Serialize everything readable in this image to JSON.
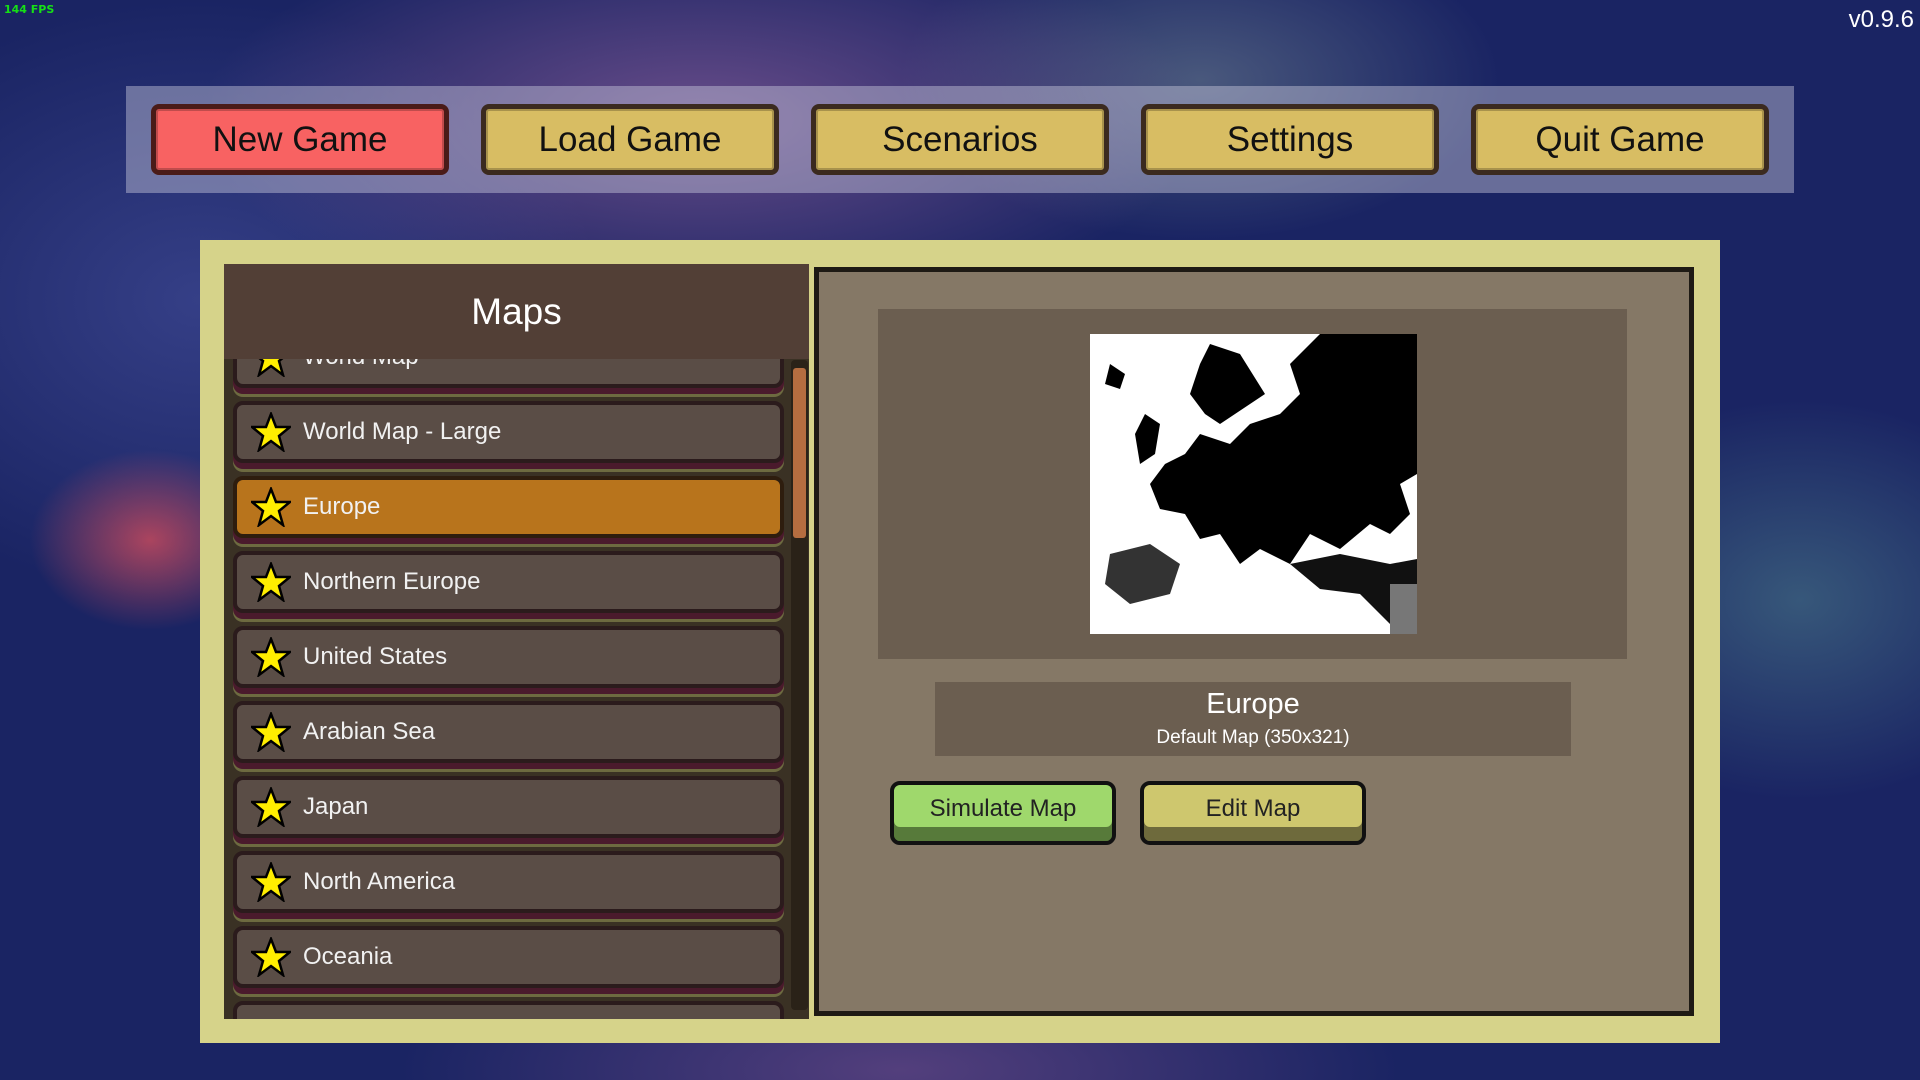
{
  "fps": "144 FPS",
  "version": "v0.9.6",
  "menu": [
    {
      "label": "New Game",
      "active": true
    },
    {
      "label": "Load Game"
    },
    {
      "label": "Scenarios"
    },
    {
      "label": "Settings"
    },
    {
      "label": "Quit Game"
    }
  ],
  "maps": {
    "title": "Maps",
    "items": [
      "World Map",
      "World Map - Large",
      "Europe",
      "Northern Europe",
      "United States",
      "Arabian Sea",
      "Japan",
      "North America",
      "Oceania"
    ],
    "selected": "Europe",
    "scroll_position": 0.0
  },
  "detail": {
    "name": "Europe",
    "subtitle": "Default Map (350x321)",
    "simulate_label": "Simulate Map",
    "edit_label": "Edit Map"
  },
  "colors": {
    "accent_active": "#f86262",
    "menu_button": "#d8bd63",
    "selected_row": "#b8741c",
    "simulate": "#9fd86c",
    "edit": "#cec76e",
    "star": "#ffee00"
  }
}
